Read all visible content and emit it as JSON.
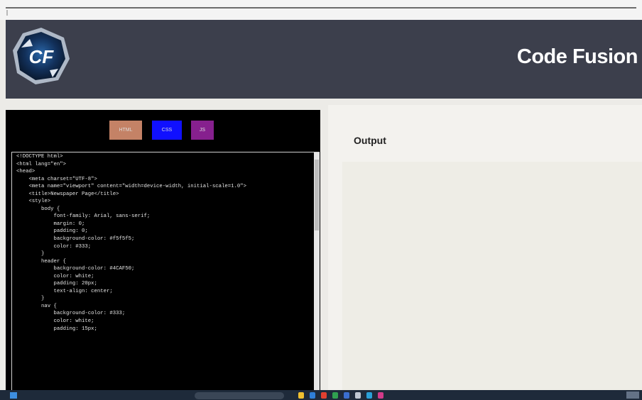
{
  "header": {
    "brand_title": "Code Fusion",
    "logo_text": "CF",
    "colors": {
      "bar": "#3c3f4c",
      "logo_ring": "#1f6fa8",
      "logo_core": "#12305a"
    }
  },
  "editor": {
    "buttons": [
      {
        "label": "HTML",
        "color": "#c48266"
      },
      {
        "label": "CSS",
        "color": "#1010ff"
      },
      {
        "label": "JS",
        "color": "#86208e"
      }
    ],
    "code": "<!DOCTYPE html>\n<html lang=\"en\">\n<head>\n    <meta charset=\"UTF-8\">\n    <meta name=\"viewport\" content=\"width=device-width, initial-scale=1.0\">\n    <title>Newspaper Page</title>\n    <style>\n        body {\n            font-family: Arial, sans-serif;\n            margin: 0;\n            padding: 0;\n            background-color: #f5f5f5;\n            color: #333;\n        }\n        header {\n            background-color: #4CAF50;\n            color: white;\n            padding: 20px;\n            text-align: center;\n        }\n        nav {\n            background-color: #333;\n            color: white;\n            padding: 15px;"
  },
  "output": {
    "label": "Output"
  },
  "taskbar": {
    "icons": [
      "start-icon",
      "search-box",
      "app-icons",
      "clock"
    ]
  }
}
